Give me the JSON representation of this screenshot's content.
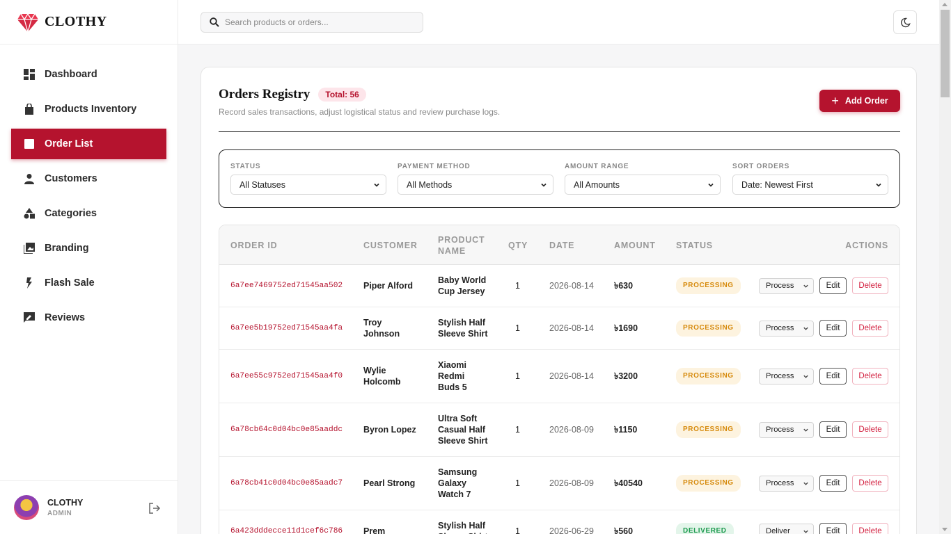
{
  "brand": {
    "name": "CLOTHY"
  },
  "nav": [
    {
      "label": "Dashboard",
      "icon": "dashboard-icon"
    },
    {
      "label": "Products Inventory",
      "icon": "bag-icon"
    },
    {
      "label": "Order List",
      "icon": "list-icon",
      "active": true
    },
    {
      "label": "Customers",
      "icon": "person-icon"
    },
    {
      "label": "Categories",
      "icon": "shapes-icon"
    },
    {
      "label": "Branding",
      "icon": "image-icon"
    },
    {
      "label": "Flash Sale",
      "icon": "bolt-icon"
    },
    {
      "label": "Reviews",
      "icon": "review-icon"
    }
  ],
  "user": {
    "name": "CLOTHY",
    "role": "ADMIN"
  },
  "search": {
    "placeholder": "Search products or orders..."
  },
  "page": {
    "title": "Orders Registry",
    "total_badge": "Total: 56",
    "subtitle": "Record sales transactions, adjust logistical status and review purchase logs.",
    "add_button": "Add Order"
  },
  "filters": [
    {
      "label": "STATUS",
      "value": "All Statuses"
    },
    {
      "label": "PAYMENT METHOD",
      "value": "All Methods"
    },
    {
      "label": "AMOUNT RANGE",
      "value": "All Amounts"
    },
    {
      "label": "SORT ORDERS",
      "value": "Date: Newest First"
    }
  ],
  "table": {
    "headers": [
      "ORDER ID",
      "CUSTOMER",
      "PRODUCT NAME",
      "QTY",
      "DATE",
      "AMOUNT",
      "STATUS",
      "ACTIONS"
    ],
    "edit_label": "Edit",
    "delete_label": "Delete",
    "rows": [
      {
        "id": "6a7ee7469752ed71545aa502",
        "customer": "Piper Alford",
        "product": "Baby World Cup Jersey",
        "qty": "1",
        "date": "2026-08-14",
        "amount": "৳630",
        "status": "PROCESSING",
        "action": "Process"
      },
      {
        "id": "6a7ee5b19752ed71545aa4fa",
        "customer": "Troy Johnson",
        "product": "Stylish Half Sleeve Shirt",
        "qty": "1",
        "date": "2026-08-14",
        "amount": "৳1690",
        "status": "PROCESSING",
        "action": "Process"
      },
      {
        "id": "6a7ee55c9752ed71545aa4f0",
        "customer": "Wylie Holcomb",
        "product": "Xiaomi Redmi Buds 5",
        "qty": "1",
        "date": "2026-08-14",
        "amount": "৳3200",
        "status": "PROCESSING",
        "action": "Process"
      },
      {
        "id": "6a78cb64c0d04bc0e85aaddc",
        "customer": "Byron Lopez",
        "product": "Ultra Soft Casual Half Sleeve Shirt",
        "qty": "1",
        "date": "2026-08-09",
        "amount": "৳1150",
        "status": "PROCESSING",
        "action": "Process"
      },
      {
        "id": "6a78cb41c0d04bc0e85aadc7",
        "customer": "Pearl Strong",
        "product": "Samsung Galaxy Watch 7",
        "qty": "1",
        "date": "2026-08-09",
        "amount": "৳40540",
        "status": "PROCESSING",
        "action": "Process"
      },
      {
        "id": "6a423dddecce11d1cef6c786",
        "customer": "Prem",
        "product": "Stylish Half Sleeve Shirt",
        "qty": "1",
        "date": "2026-06-29",
        "amount": "৳560",
        "status": "DELIVERED",
        "action": "Deliver"
      }
    ]
  },
  "colors": {
    "accent": "#b5132e",
    "processing": "#d68a0c",
    "delivered": "#1c9a4e"
  }
}
